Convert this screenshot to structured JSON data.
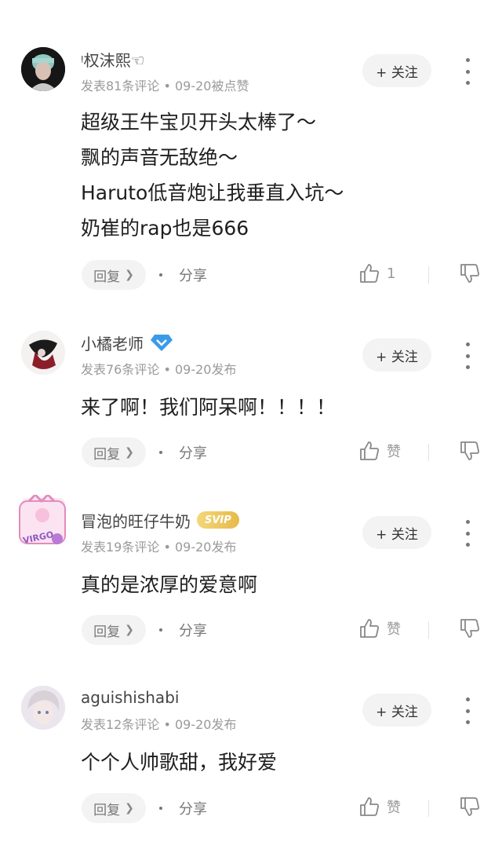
{
  "comments": [
    {
      "username": "ᵎ权沫熙☜",
      "meta": "发表81条评论 • 09-20被点赞",
      "follow_label": "+ 关注",
      "lines": [
        "超级王牛宝贝开头太棒了～",
        "飘的声音无敌绝～",
        "Haruto低音炮让我垂直入坑～",
        "奶崔的rap也是666"
      ],
      "reply_label": "回复",
      "share_label": "分享",
      "like_text": "1",
      "badge": null
    },
    {
      "username": "小橘老师",
      "meta": "发表76条评论 • 09-20发布",
      "follow_label": "+ 关注",
      "lines": [
        "来了啊！我们阿呆啊！！！！"
      ],
      "reply_label": "回复",
      "share_label": "分享",
      "like_text": "赞",
      "badge": "diamond"
    },
    {
      "username": "冒泡的旺仔牛奶",
      "meta": "发表19条评论 • 09-20发布",
      "follow_label": "+ 关注",
      "lines": [
        "真的是浓厚的爱意啊"
      ],
      "reply_label": "回复",
      "share_label": "分享",
      "like_text": "赞",
      "badge": "SVIP",
      "avatar_text": "VIRGO"
    },
    {
      "username": "aguishishabi",
      "meta": "发表12条评论 • 09-20发布",
      "follow_label": "+ 关注",
      "lines": [
        "个个人帅歌甜，我好爱"
      ],
      "reply_label": "回复",
      "share_label": "分享",
      "like_text": "赞",
      "badge": null
    }
  ],
  "colors": {
    "follow_bg": "#f3f3f3",
    "meta_text": "#9a9a9a",
    "diamond_badge": "#3a9be8",
    "svip_gold": "#e8b94a"
  }
}
